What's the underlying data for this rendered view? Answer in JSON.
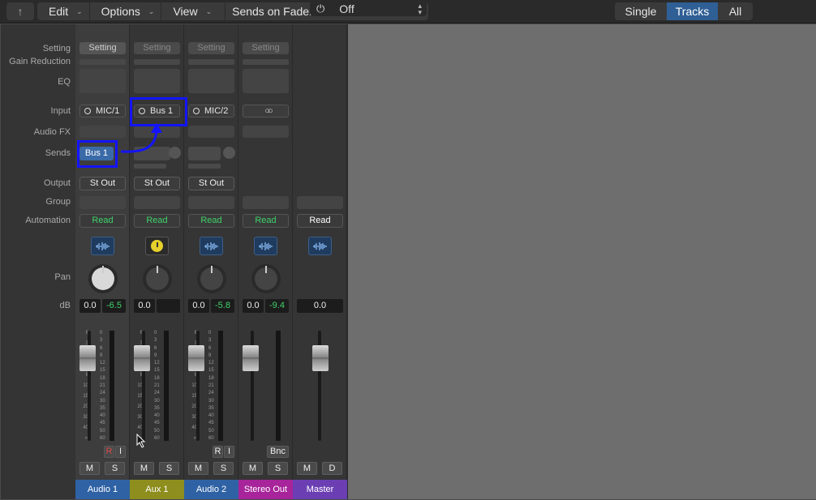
{
  "toolbar": {
    "up_icon": "arrow-up-icon",
    "menus": [
      {
        "label": "Edit"
      },
      {
        "label": "Options"
      },
      {
        "label": "View"
      }
    ],
    "sends_on_faders_label": "Sends on Faders:",
    "sends_on_faders_value": "Off",
    "view_modes": [
      {
        "label": "Single",
        "active": false
      },
      {
        "label": "Tracks",
        "active": true
      },
      {
        "label": "All",
        "active": false
      }
    ]
  },
  "row_labels": {
    "setting": "Setting",
    "gain_reduction": "Gain Reduction",
    "eq": "EQ",
    "input": "Input",
    "audio_fx": "Audio FX",
    "sends": "Sends",
    "output": "Output",
    "group": "Group",
    "automation": "Automation",
    "pan": "Pan",
    "db": "dB"
  },
  "colors": {
    "accent_blue": "#2f5f95",
    "audio_track": "#2f62a4",
    "aux_track": "#8e8e1e",
    "stereo_out": "#a7249a",
    "master": "#6b3fb3",
    "read_green": "#3fd36a",
    "highlight": "#1414ff"
  },
  "strips": [
    {
      "name": "Audio 1",
      "setting": "Setting",
      "input": "MIC/1",
      "send": "Bus 1",
      "output": "St Out",
      "automation": "Read",
      "volume": "0.0",
      "peak": "-6.5",
      "record": "R",
      "input_monitor": "I",
      "mute": "M",
      "solo": "S",
      "fader_level_db": 0.0
    },
    {
      "name": "Aux 1",
      "setting": "Setting",
      "input": "Bus 1",
      "output": "St Out",
      "automation": "Read",
      "volume": "0.0",
      "peak": "",
      "mute": "M",
      "solo": "S",
      "fader_level_db": 0.0
    },
    {
      "name": "Audio 2",
      "setting": "Setting",
      "input": "MIC/2",
      "output": "St Out",
      "automation": "Read",
      "volume": "0.0",
      "peak": "-5.8",
      "record": "R",
      "input_monitor": "I",
      "mute": "M",
      "solo": "S",
      "fader_level_db": 0.0
    },
    {
      "name": "Stereo Out",
      "setting": "Setting",
      "input_icon": "stereo-link-icon",
      "automation": "Read",
      "volume": "0.0",
      "peak": "-9.4",
      "bounce": "Bnc",
      "mute": "M",
      "solo": "S",
      "fader_level_db": 0.0
    },
    {
      "name": "Master",
      "automation": "Read",
      "volume": "0.0",
      "mute": "M",
      "dim": "D",
      "fader_level_db": 0.0
    }
  ],
  "fader_scale": [
    "6",
    "3",
    "0",
    "3",
    "6",
    "10",
    "15",
    "20",
    "30",
    "40",
    "∞"
  ],
  "meter_scale": [
    "0",
    "3",
    "6",
    "9",
    "12",
    "15",
    "18",
    "21",
    "24",
    "30",
    "35",
    "40",
    "45",
    "50",
    "60"
  ]
}
